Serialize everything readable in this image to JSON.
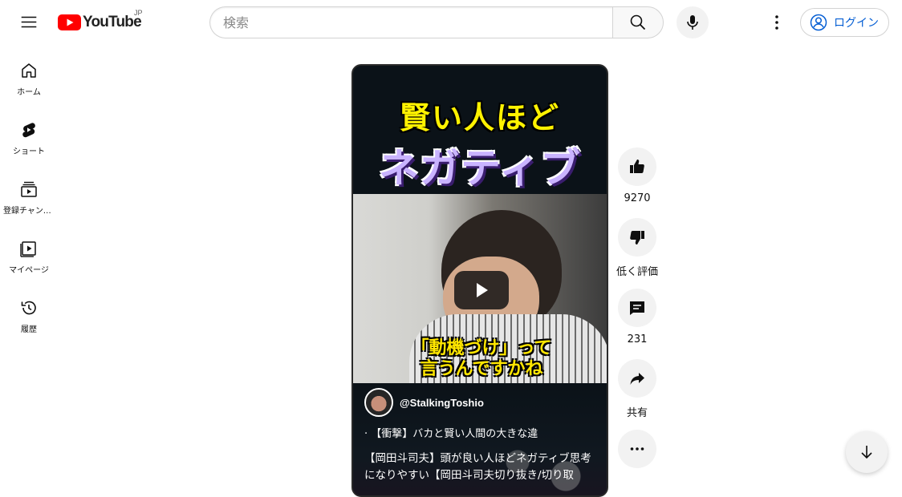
{
  "header": {
    "logo_text": "YouTube",
    "logo_region": "JP",
    "search_placeholder": "検索",
    "login_label": "ログイン"
  },
  "sidebar": {
    "items": [
      {
        "label": "ホーム",
        "icon": "home-icon"
      },
      {
        "label": "ショート",
        "icon": "shorts-icon"
      },
      {
        "label": "登録チャンネル",
        "icon": "subscriptions-icon"
      },
      {
        "label": "マイページ",
        "icon": "you-icon"
      },
      {
        "label": "履歴",
        "icon": "history-icon"
      }
    ]
  },
  "short": {
    "overlay_title_1": "賢い人ほど",
    "overlay_title_2": "ネガティブ",
    "caption_line_1": "「動機づけ」って",
    "caption_line_2": "言うんですかね",
    "channel_handle": "@StalkingToshio",
    "audio_text": "·  【衝撃】バカと賢い人間の大きな違",
    "description": "【岡田斗司夫】頭が良い人ほどネガティブ思考になりやすい【岡田斗司夫切り抜き/切り取"
  },
  "actions": {
    "like_count": "9270",
    "dislike_label": "低く評価",
    "comment_count": "231",
    "share_label": "共有"
  },
  "colors": {
    "youtube_red": "#ff0000",
    "link_blue": "#065fd4",
    "title_yellow": "#fff200",
    "title_purple": "#c9b3ff"
  }
}
